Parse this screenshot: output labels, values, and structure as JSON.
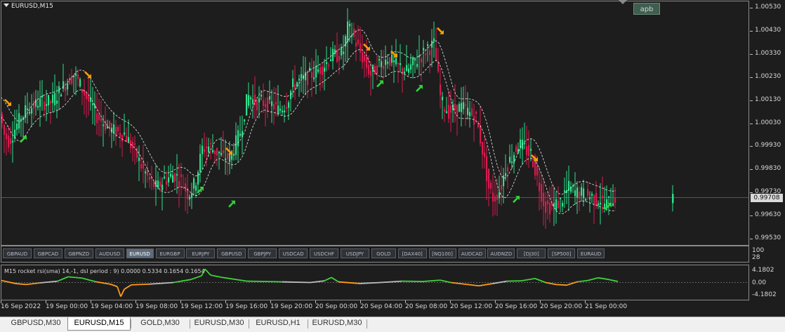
{
  "window": {
    "title": "EURUSD,M15"
  },
  "apb_button": {
    "label": "apb"
  },
  "price_axis": {
    "labels": [
      "1.00530",
      "1.00430",
      "1.00330",
      "1.00230",
      "1.00130",
      "1.00030",
      "0.99930",
      "0.99830",
      "0.99730",
      "0.99630",
      "0.99530"
    ],
    "current_price": "0.99708"
  },
  "symbol_bar": {
    "symbols": [
      "GBPAUD",
      "GBPCAD",
      "GBPNZD",
      "AUDUSD",
      "EURUSD",
      "EURGBP",
      "EURJPY",
      "GBPUSD",
      "GBPJPY",
      "USDCAD",
      "USDCHF",
      "USDJPY",
      "GOLD",
      "[DAX40]",
      "[NQ100]",
      "AUDCAD",
      "AUDNZD",
      "[DJ30]",
      "[SP500]",
      "EURAUD"
    ],
    "active": "EURUSD",
    "scale_labels": [
      "100",
      "28"
    ]
  },
  "indicator": {
    "label": "M15 rocket rsi(sma) 14,-1, dsl period : 9) 0.0000 0.5334 0.1654 0.1654",
    "scale_labels": [
      "4.1802",
      "0.00",
      "-4.1802"
    ]
  },
  "time_axis": {
    "labels": [
      "16 Sep 2022",
      "19 Sep 00:00",
      "19 Sep 04:00",
      "19 Sep 08:00",
      "19 Sep 12:00",
      "19 Sep 16:00",
      "19 Sep 20:00",
      "20 Sep 00:00",
      "20 Sep 04:00",
      "20 Sep 08:00",
      "20 Sep 12:00",
      "20 Sep 16:00",
      "20 Sep 20:00",
      "21 Sep 00:00"
    ]
  },
  "tabs": [
    "GBPUSD,M30",
    "EURUSD,M15",
    "GOLD,M30",
    "EURUSD,M30",
    "EURUSD,H1",
    "EURUSD,M30"
  ],
  "active_tab": "EURUSD,M15",
  "colors": {
    "bull": "#2fe08a",
    "bear": "#d81b4e",
    "buy_arrow": "#32d23c",
    "sell_arrow": "#ffa000",
    "band": "#e8e8e8",
    "rsi_up": "#3fd23a",
    "rsi_down": "#ff9b1a",
    "rsi_neutral": "#bdbdbd"
  },
  "chart_data": {
    "type": "candlestick",
    "symbol": "EURUSD",
    "timeframe": "M15",
    "ylim": [
      0.995,
      1.0056
    ],
    "current_price": 0.99708,
    "path_points": [
      [
        0,
        1.001
      ],
      [
        8,
        0.9998
      ],
      [
        15,
        0.9995
      ],
      [
        25,
        1.0002
      ],
      [
        40,
        1.0009
      ],
      [
        60,
        1.0012
      ],
      [
        75,
        1.0012
      ],
      [
        90,
        1.0018
      ],
      [
        100,
        1.0022
      ],
      [
        108,
        1.0024
      ],
      [
        115,
        1.002
      ],
      [
        125,
        1.0014
      ],
      [
        140,
        1.0006
      ],
      [
        160,
        1.0
      ],
      [
        180,
        0.9998
      ],
      [
        195,
        0.999
      ],
      [
        205,
        0.9983
      ],
      [
        215,
        0.9978
      ],
      [
        225,
        0.9975
      ],
      [
        235,
        0.9978
      ],
      [
        250,
        0.9981
      ],
      [
        260,
        0.9978
      ],
      [
        270,
        0.9972
      ],
      [
        280,
        0.9977
      ],
      [
        290,
        0.9992
      ],
      [
        300,
        0.9993
      ],
      [
        320,
        0.9988
      ],
      [
        330,
        0.9988
      ],
      [
        345,
        1.0
      ],
      [
        355,
        1.0015
      ],
      [
        365,
        1.0012
      ],
      [
        375,
        1.0012
      ],
      [
        390,
        1.0011
      ],
      [
        400,
        1.0008
      ],
      [
        410,
        1.0012
      ],
      [
        420,
        1.002
      ],
      [
        440,
        1.0023
      ],
      [
        460,
        1.0027
      ],
      [
        475,
        1.0032
      ],
      [
        490,
        1.0033
      ],
      [
        497,
        1.0044
      ],
      [
        503,
        1.0042
      ],
      [
        510,
        1.0037
      ],
      [
        520,
        1.003
      ],
      [
        530,
        1.0024
      ],
      [
        540,
        1.0028
      ],
      [
        555,
        1.0031
      ],
      [
        565,
        1.0028
      ],
      [
        580,
        1.0025
      ],
      [
        595,
        1.003
      ],
      [
        610,
        1.0035
      ],
      [
        620,
        1.0037
      ],
      [
        625,
        1.0025
      ],
      [
        630,
        1.0012
      ],
      [
        640,
        1.0008
      ],
      [
        660,
        1.001
      ],
      [
        680,
        1.0005
      ],
      [
        690,
        0.999
      ],
      [
        698,
        0.9975
      ],
      [
        705,
        0.997
      ],
      [
        715,
        0.9975
      ],
      [
        722,
        0.9984
      ],
      [
        730,
        0.9988
      ],
      [
        740,
        0.9994
      ],
      [
        750,
        0.9992
      ],
      [
        760,
        0.9988
      ],
      [
        768,
        0.9978
      ],
      [
        778,
        0.9967
      ],
      [
        788,
        0.9967
      ],
      [
        800,
        0.9969
      ],
      [
        812,
        0.9975
      ],
      [
        822,
        0.9973
      ],
      [
        835,
        0.9972
      ],
      [
        850,
        0.997
      ],
      [
        865,
        0.9968
      ],
      [
        878,
        0.9971
      ]
    ],
    "sell_signals": [
      [
        10,
        1.0012
      ],
      [
        124,
        1.0024
      ],
      [
        325,
        0.9991
      ],
      [
        521,
        1.0036
      ],
      [
        560,
        1.0033
      ],
      [
        626,
        1.0043
      ],
      [
        760,
        0.9988
      ]
    ],
    "buy_signals": [
      [
        32,
        0.9996
      ],
      [
        284,
        0.9974
      ],
      [
        329,
        0.9968
      ],
      [
        540,
        1.002
      ],
      [
        596,
        1.0018
      ],
      [
        734,
        0.997
      ],
      [
        865,
        0.9967
      ]
    ],
    "indicator_series": {
      "name": "rocket rsi",
      "ylim": [
        -4.1802,
        4.1802
      ],
      "points": [
        [
          0,
          0.6
        ],
        [
          20,
          -0.3
        ],
        [
          35,
          -0.6
        ],
        [
          55,
          -0.1
        ],
        [
          80,
          0.4
        ],
        [
          95,
          1.7
        ],
        [
          115,
          1.3
        ],
        [
          135,
          0.2
        ],
        [
          155,
          -0.5
        ],
        [
          165,
          -1.2
        ],
        [
          170,
          -4.2
        ],
        [
          175,
          -2.0
        ],
        [
          185,
          -0.7
        ],
        [
          210,
          -0.5
        ],
        [
          245,
          0.0
        ],
        [
          270,
          0.9
        ],
        [
          285,
          2.0
        ],
        [
          290,
          4.0
        ],
        [
          298,
          2.2
        ],
        [
          315,
          1.5
        ],
        [
          350,
          0.4
        ],
        [
          400,
          0.2
        ],
        [
          440,
          0.0
        ],
        [
          460,
          0.5
        ],
        [
          470,
          1.5
        ],
        [
          480,
          0.2
        ],
        [
          510,
          -0.3
        ],
        [
          540,
          0.0
        ],
        [
          570,
          0.4
        ],
        [
          600,
          0.3
        ],
        [
          625,
          0.7
        ],
        [
          640,
          0.0
        ],
        [
          660,
          -0.5
        ],
        [
          680,
          -1.0
        ],
        [
          700,
          -0.3
        ],
        [
          720,
          0.4
        ],
        [
          740,
          0.5
        ],
        [
          760,
          1.2
        ],
        [
          775,
          0.0
        ],
        [
          790,
          -0.6
        ],
        [
          805,
          -0.8
        ],
        [
          820,
          0.2
        ],
        [
          835,
          0.6
        ],
        [
          850,
          1.4
        ],
        [
          865,
          0.9
        ],
        [
          878,
          0.3
        ]
      ]
    }
  }
}
